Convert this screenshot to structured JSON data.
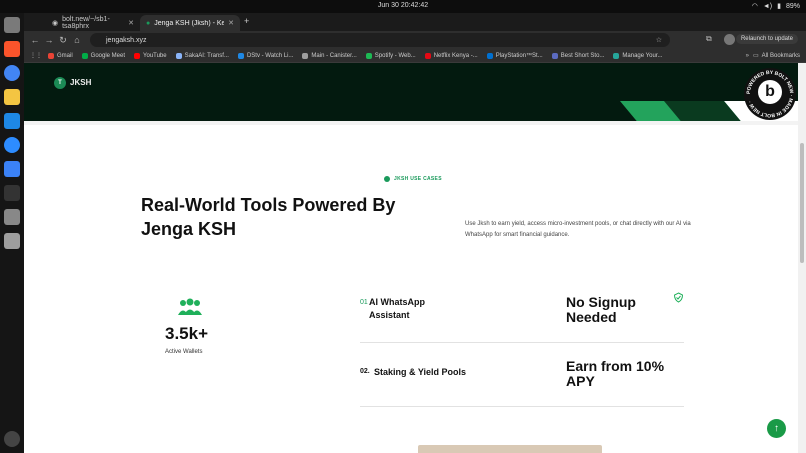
{
  "system": {
    "clock": "Jun 30  20:42:42",
    "battery": "89%"
  },
  "browser": {
    "tabs": [
      {
        "label": "bolt.new/~/sb1-tsa8phrx"
      },
      {
        "label": "Jenga KSH (Jksh) - Kenya"
      }
    ],
    "url": "jengaksh.xyz",
    "relaunch": "Relaunch to update",
    "bookmarks": [
      {
        "label": "Gmail",
        "color": "#ea4335"
      },
      {
        "label": "Google Meet",
        "color": "#00ac47"
      },
      {
        "label": "YouTube",
        "color": "#ff0000"
      },
      {
        "label": "SakaAI: Transf...",
        "color": "#8ab4f8"
      },
      {
        "label": "DStv - Watch Li...",
        "color": "#1e88e5"
      },
      {
        "label": "Main - Canister...",
        "color": "#9e9e9e"
      },
      {
        "label": "Spotify - Web...",
        "color": "#1db954"
      },
      {
        "label": "Netflix Kenya -...",
        "color": "#e50914"
      },
      {
        "label": "PlayStation™St...",
        "color": "#0070d1"
      },
      {
        "label": "Best Short Sto...",
        "color": "#5c6bc0"
      },
      {
        "label": "Manage Your...",
        "color": "#26a69a"
      }
    ],
    "all_bookmarks": "All Bookmarks"
  },
  "site": {
    "logo_letter": "T",
    "logo_text": "JKSH",
    "section_tag": "JKSH USE CASES",
    "heading": "Real-World Tools Powered By Jenga KSH",
    "lead": "Use Jksh to earn yield, access micro-investment pools, or chat directly with our AI via WhatsApp for smart financial guidance.",
    "stat": {
      "value": "3.5k+",
      "label": "Active Wallets"
    },
    "features": [
      {
        "num": "01",
        "name": "AI WhatsApp Assistant",
        "highlight": "No Signup Needed"
      },
      {
        "num": "02.",
        "name": "Staking & Yield Pools",
        "highlight": "Earn from 10% APY"
      }
    ],
    "bolt_badge": "POWERED BY BOLT NEW · MADE IN BOLT NEW ·",
    "accent": "#1a9a5b"
  }
}
